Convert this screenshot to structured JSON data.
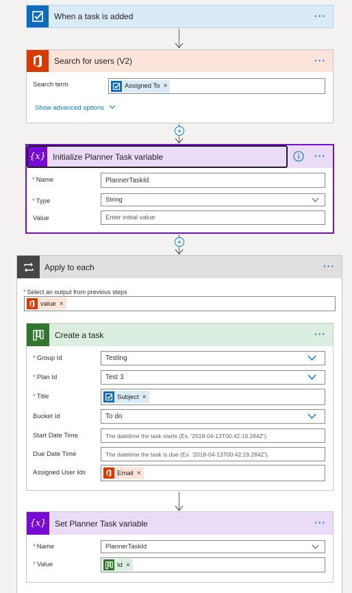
{
  "trigger": {
    "title": "When a task is added",
    "icon": "checkbox-icon",
    "color": "#0f6cbd"
  },
  "search_users": {
    "title": "Search for users (V2)",
    "icon": "office-icon",
    "color": "#d83b01",
    "search_term_label": "Search term",
    "token": {
      "label": "Assigned To",
      "icon": "checkbox-icon"
    },
    "advanced_link": "Show advanced options"
  },
  "init_var": {
    "title": "Initialize Planner Task variable",
    "icon": "variable-icon",
    "color": "#770bd6",
    "name_label": "Name",
    "name_value": "PlannerTaskId",
    "type_label": "Type",
    "type_value": "String",
    "value_label": "Value",
    "value_placeholder": "Enter initial value"
  },
  "apply_each": {
    "title": "Apply to each",
    "icon": "loop-icon",
    "select_label": "Select an output from previous steps",
    "token": {
      "label": "value",
      "icon": "office-icon"
    }
  },
  "create_task": {
    "title": "Create a task",
    "icon": "planner-icon",
    "color": "#31752f",
    "group_label": "Group Id",
    "group_value": "Testing",
    "plan_label": "Plan Id",
    "plan_value": "Test 3",
    "title_label": "Title",
    "title_token": {
      "label": "Subject",
      "icon": "checkbox-icon"
    },
    "bucket_label": "Bucket Id",
    "bucket_value": "To do",
    "start_label": "Start Date Time",
    "start_placeholder": "The datetime the task starts (Ex. '2018-04-13T00:42:19.284Z').",
    "due_label": "Due Date Time",
    "due_placeholder": "The datetime the task is due (Ex. '2018-04-13T00:42:19.284Z').",
    "assigned_label": "Assigned User Ids",
    "assigned_token": {
      "label": "Email",
      "icon": "office-icon"
    }
  },
  "set_var": {
    "title": "Set Planner Task variable",
    "icon": "variable-icon",
    "color": "#770bd6",
    "name_label": "Name",
    "name_value": "PlannerTaskId",
    "value_label": "Value",
    "value_token": {
      "label": "Id",
      "icon": "planner-icon"
    }
  },
  "more_label": "···",
  "required_mark": "*",
  "remove_mark": "×",
  "add_mark": "+"
}
